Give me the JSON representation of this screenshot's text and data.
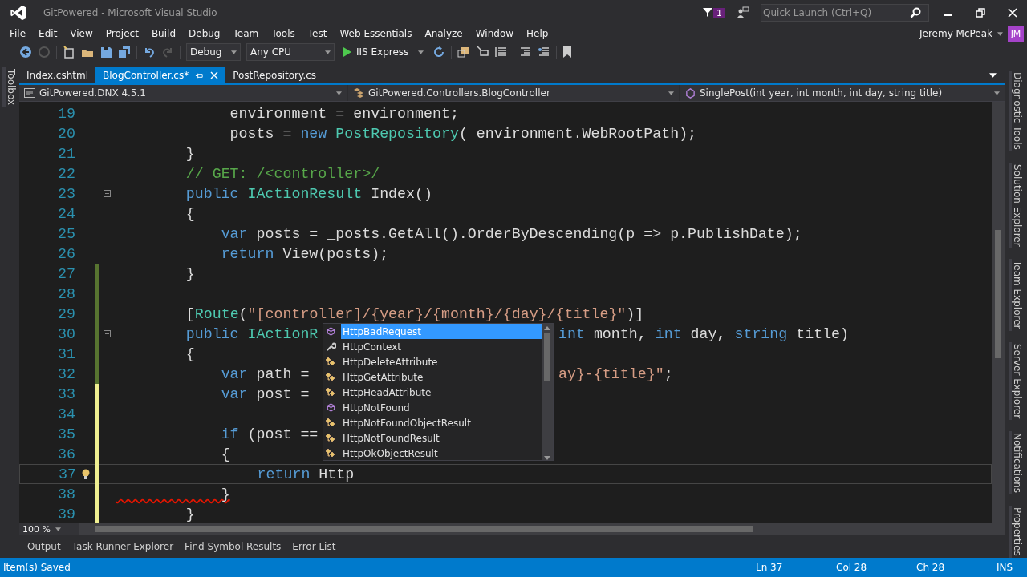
{
  "window": {
    "title": "GitPowered - Microsoft Visual Studio",
    "notification_count": "1",
    "quick_launch": {
      "placeholder": "Quick Launch (Ctrl+Q)"
    }
  },
  "menu": [
    "File",
    "Edit",
    "View",
    "Project",
    "Build",
    "Debug",
    "Team",
    "Tools",
    "Test",
    "Web Essentials",
    "Analyze",
    "Window",
    "Help"
  ],
  "user": {
    "name": "Jeremy McPeak",
    "initials": "JM"
  },
  "toolbar": {
    "configuration": "Debug",
    "platform": "Any CPU",
    "run_target": "IIS Express"
  },
  "left_rail": [
    "Toolbox"
  ],
  "doc_tabs": [
    {
      "label": "Index.cshtml",
      "selected": false
    },
    {
      "label": "BlogController.cs*",
      "selected": true
    },
    {
      "label": "PostRepository.cs",
      "selected": false
    }
  ],
  "nav_bar": {
    "project": "GitPowered.DNX 4.5.1",
    "class": "GitPowered.Controllers.BlogController",
    "member": "SinglePost(int year, int month, int day, string title)"
  },
  "code_lines": [
    {
      "number": "19",
      "tokens": [
        {
          "kind": "plain",
          "text": "            _environment = environment;"
        }
      ]
    },
    {
      "number": "20",
      "tokens": [
        {
          "kind": "plain",
          "text": "            _posts = "
        },
        {
          "kind": "keyword",
          "text": "new"
        },
        {
          "kind": "type",
          "text": " PostRepository"
        },
        {
          "kind": "plain",
          "text": "(_environment.WebRootPath);"
        }
      ]
    },
    {
      "number": "21",
      "tokens": [
        {
          "kind": "plain",
          "text": "        }"
        }
      ]
    },
    {
      "number": "22",
      "tokens": [
        {
          "kind": "comment",
          "text": "        // GET: /<controller>/"
        }
      ]
    },
    {
      "number": "23",
      "collapsible": true,
      "tokens": [
        {
          "kind": "keyword",
          "text": "        public"
        },
        {
          "kind": "type",
          "text": " IActionResult"
        },
        {
          "kind": "plain",
          "text": " Index()"
        }
      ]
    },
    {
      "number": "24",
      "tokens": [
        {
          "kind": "plain",
          "text": "        {"
        }
      ]
    },
    {
      "number": "25",
      "tokens": [
        {
          "kind": "keyword",
          "text": "            var"
        },
        {
          "kind": "plain",
          "text": " posts = _posts.GetAll().OrderByDescending(p => p.PublishDate);"
        }
      ]
    },
    {
      "number": "26",
      "tokens": [
        {
          "kind": "keyword",
          "text": "            return"
        },
        {
          "kind": "plain",
          "text": " View(posts);"
        }
      ]
    },
    {
      "number": "27",
      "changed": true,
      "saved": true,
      "tokens": [
        {
          "kind": "plain",
          "text": "        }"
        }
      ]
    },
    {
      "number": "28",
      "changed": true,
      "saved": true
    },
    {
      "number": "29",
      "changed": true,
      "saved": true,
      "tokens": [
        {
          "kind": "plain",
          "text": "        ["
        },
        {
          "kind": "type",
          "text": "Route"
        },
        {
          "kind": "plain",
          "text": "("
        },
        {
          "kind": "string",
          "text": "\"[controller]/{year}/{month}/{day}/{title}\""
        },
        {
          "kind": "plain",
          "text": ")]"
        }
      ]
    },
    {
      "number": "30",
      "changed": true,
      "saved": true,
      "collapsible": true,
      "tokens": [
        {
          "kind": "keyword",
          "text": "        public"
        },
        {
          "kind": "type",
          "text": " IActionR"
        }
      ],
      "tokens_right": [
        {
          "kind": "keyword",
          "text": "int"
        },
        {
          "kind": "plain",
          "text": " month, "
        },
        {
          "kind": "keyword",
          "text": "int"
        },
        {
          "kind": "plain",
          "text": " day, "
        },
        {
          "kind": "keyword",
          "text": "string"
        },
        {
          "kind": "plain",
          "text": " title)"
        }
      ]
    },
    {
      "number": "31",
      "changed": true,
      "saved": true,
      "tokens": [
        {
          "kind": "plain",
          "text": "        {"
        }
      ]
    },
    {
      "number": "32",
      "changed": true,
      "saved": true,
      "tokens": [
        {
          "kind": "keyword",
          "text": "            var"
        },
        {
          "kind": "plain",
          "text": " path ="
        }
      ],
      "tokens_right": [
        {
          "kind": "string",
          "text": "ay}-{title}\""
        },
        {
          "kind": "plain",
          "text": ";"
        }
      ]
    },
    {
      "number": "33",
      "changed": true,
      "saved": false,
      "tokens": [
        {
          "kind": "keyword",
          "text": "            var"
        },
        {
          "kind": "plain",
          "text": " post ="
        }
      ]
    },
    {
      "number": "34",
      "changed": true,
      "saved": false
    },
    {
      "number": "35",
      "changed": true,
      "saved": false,
      "tokens": [
        {
          "kind": "keyword",
          "text": "            if"
        },
        {
          "kind": "plain",
          "text": " (post =="
        }
      ]
    },
    {
      "number": "36",
      "changed": true,
      "saved": false,
      "tokens": [
        {
          "kind": "plain",
          "text": "            {"
        }
      ]
    },
    {
      "number": "37",
      "changed": true,
      "saved": false,
      "current": true,
      "lightbulb": true,
      "tokens": [
        {
          "kind": "keyword",
          "text": "                return"
        },
        {
          "kind": "plain",
          "text": " Http"
        }
      ]
    },
    {
      "number": "38",
      "changed": true,
      "saved": false,
      "error": true,
      "tokens": [
        {
          "kind": "plain",
          "text": "            }"
        }
      ]
    },
    {
      "number": "39",
      "changed": true,
      "saved": false,
      "tokens": [
        {
          "kind": "plain",
          "text": "        }"
        }
      ]
    }
  ],
  "completion": [
    {
      "label": "HttpBadRequest",
      "kind": "method",
      "selected": true
    },
    {
      "label": "HttpContext",
      "kind": "property",
      "selected": false
    },
    {
      "label": "HttpDeleteAttribute",
      "kind": "class",
      "selected": false
    },
    {
      "label": "HttpGetAttribute",
      "kind": "class",
      "selected": false
    },
    {
      "label": "HttpHeadAttribute",
      "kind": "class",
      "selected": false
    },
    {
      "label": "HttpNotFound",
      "kind": "method",
      "selected": false
    },
    {
      "label": "HttpNotFoundObjectResult",
      "kind": "class",
      "selected": false
    },
    {
      "label": "HttpNotFoundResult",
      "kind": "class",
      "selected": false
    },
    {
      "label": "HttpOkObjectResult",
      "kind": "class",
      "selected": false
    }
  ],
  "zoom": "100 %",
  "right_rail": [
    "Diagnostic Tools",
    "Solution Explorer",
    "Team Explorer",
    "Server Explorer",
    "Notifications",
    "Properties"
  ],
  "tool_tabs": [
    "Output",
    "Task Runner Explorer",
    "Find Symbol Results",
    "Error List"
  ],
  "status_bar": {
    "message": "Item(s) Saved",
    "line": "Ln 37",
    "column": "Col 28",
    "char": "Ch 28",
    "mode": "INS"
  }
}
